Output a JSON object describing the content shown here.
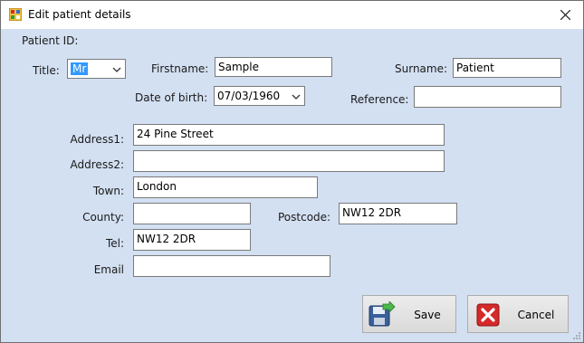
{
  "window": {
    "title": "Edit patient details"
  },
  "labels": {
    "patient_id": "Patient ID:",
    "title": "Title:",
    "firstname": "Firstname:",
    "surname": "Surname:",
    "dob": "Date of birth:",
    "reference": "Reference:",
    "address1": "Address1:",
    "address2": "Address2:",
    "town": "Town:",
    "county": "County:",
    "postcode": "Postcode:",
    "tel": "Tel:",
    "email": "Email"
  },
  "fields": {
    "title": "Mr",
    "firstname": "Sample",
    "surname": "Patient",
    "dob": "07/03/1960",
    "reference": "",
    "address1": "24 Pine Street",
    "address2": "",
    "town": "London",
    "county": "",
    "postcode": "NW12 2DR",
    "tel": "NW12 2DR",
    "email": ""
  },
  "buttons": {
    "save": "Save",
    "cancel": "Cancel"
  },
  "icons": {
    "app": "form-icon",
    "close": "close-icon",
    "save": "floppy-disk-icon",
    "cancel": "red-x-icon"
  }
}
